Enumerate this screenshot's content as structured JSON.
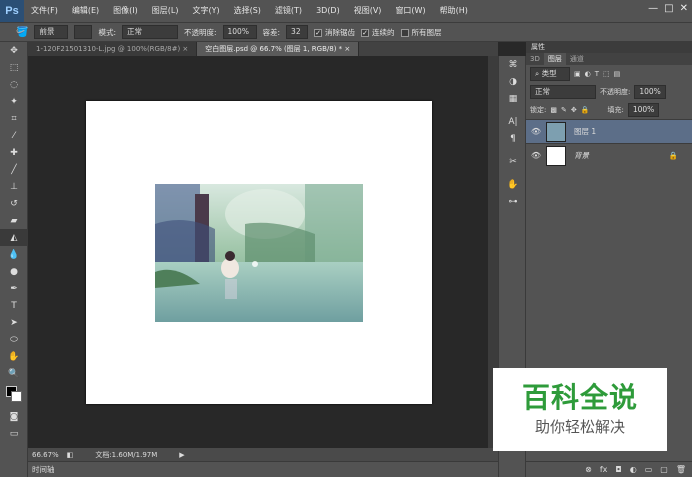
{
  "menubar": {
    "logo": "Ps",
    "items": [
      "文件(F)",
      "编辑(E)",
      "图像(I)",
      "图层(L)",
      "文字(Y)",
      "选择(S)",
      "滤镜(T)",
      "3D(D)",
      "视图(V)",
      "窗口(W)",
      "帮助(H)"
    ],
    "window_controls": [
      "—",
      "□",
      "✕"
    ]
  },
  "options": {
    "fill_source": "前景",
    "mode_label": "模式:",
    "mode_value": "正常",
    "opacity_label": "不透明度:",
    "opacity_value": "100%",
    "tolerance_label": "容差:",
    "tolerance_value": "32",
    "antialias_label": "消除锯齿",
    "contiguous_label": "连续的",
    "all_layers_label": "所有图层"
  },
  "tabs": [
    {
      "label": "1-120F21501310-L.jpg @ 100%(RGB/8#)",
      "close": "×"
    },
    {
      "label": "空白图层.psd @ 66.7% (图层 1, RGB/8) *",
      "close": "×"
    }
  ],
  "status": {
    "zoom": "66.67%",
    "doc_info": "文档:1.60M/1.97M"
  },
  "timeline": {
    "label": "时间轴"
  },
  "panel": {
    "header": "属性",
    "tabs": [
      "3D",
      "图层",
      "通道"
    ],
    "kind_label": "类型",
    "blend_mode": "正常",
    "opacity_label": "不透明度:",
    "opacity_value": "100%",
    "lock_label": "锁定:",
    "fill_label": "填充:",
    "fill_value": "100%",
    "layers": [
      {
        "name": "图层 1",
        "selected": true
      },
      {
        "name": "背景",
        "selected": false
      }
    ]
  },
  "watermark": {
    "title": "百科全说",
    "subtitle": "助你轻松解决"
  },
  "colors": {
    "accent": "#2e9b3a",
    "selected_layer": "#5c6e88"
  }
}
